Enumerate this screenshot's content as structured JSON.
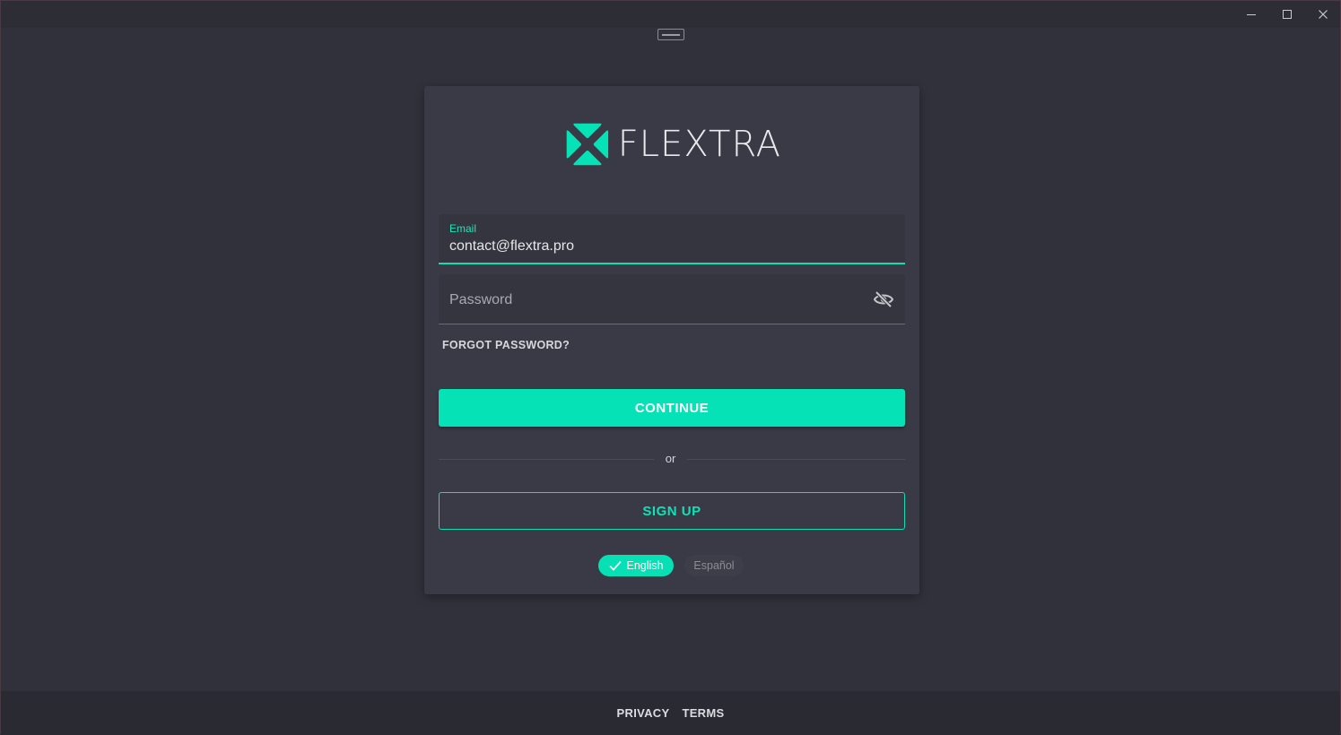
{
  "window": {
    "controls": {
      "minimize": "─",
      "maximize": "☐",
      "close": "✕"
    }
  },
  "logo": {
    "text": "FLEXTRA",
    "icon": "flextra-logo-icon",
    "accent": "#05E2B6"
  },
  "form": {
    "email": {
      "label": "Email",
      "value": "contact@flextra.pro"
    },
    "password": {
      "placeholder": "Password",
      "icon": "eye-off-icon"
    },
    "forgot_label": "FORGOT PASSWORD?",
    "continue_label": "CONTINUE",
    "divider_text": "or",
    "signup_label": "SIGN UP"
  },
  "languages": {
    "selected": "English",
    "other": "Español"
  },
  "footer": {
    "privacy_label": "PRIVACY",
    "terms_label": "TERMS"
  },
  "colors": {
    "background": "#30313B",
    "card": "#393A45",
    "accent": "#05E2B6"
  }
}
